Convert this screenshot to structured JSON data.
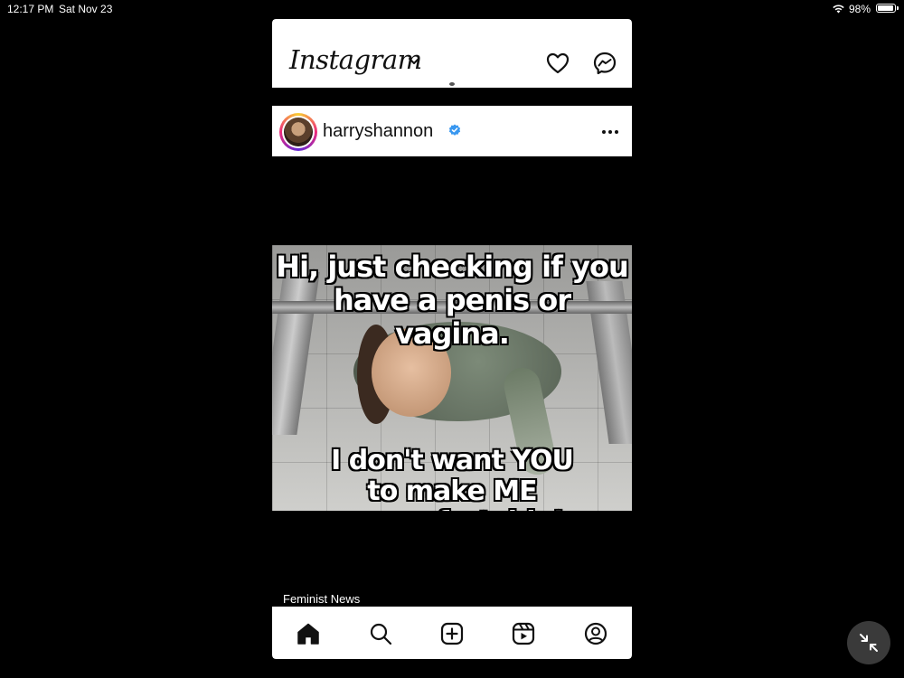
{
  "status_bar": {
    "time": "12:17 PM",
    "date": "Sat Nov 23",
    "battery": "98%"
  },
  "header": {
    "logo": "Instagram",
    "icons": [
      "chevron-down-icon",
      "heart-icon",
      "messenger-icon"
    ]
  },
  "post": {
    "username": "harryshannon",
    "verified": true,
    "meme_top_line1": "Hi, just checking if you",
    "meme_top_line2": "have a penis or vagina.",
    "meme_bottom_line1": "I don't want YOU",
    "meme_bottom_line2": "to make ME uncomfortable!"
  },
  "next_post": {
    "label": "Feminist News"
  },
  "tabbar": {
    "items": [
      "home-icon",
      "search-icon",
      "add-icon",
      "reels-icon",
      "profile-icon"
    ]
  },
  "colors": {
    "background": "#000000",
    "panel": "#ffffff",
    "verified": "#3897f0"
  }
}
